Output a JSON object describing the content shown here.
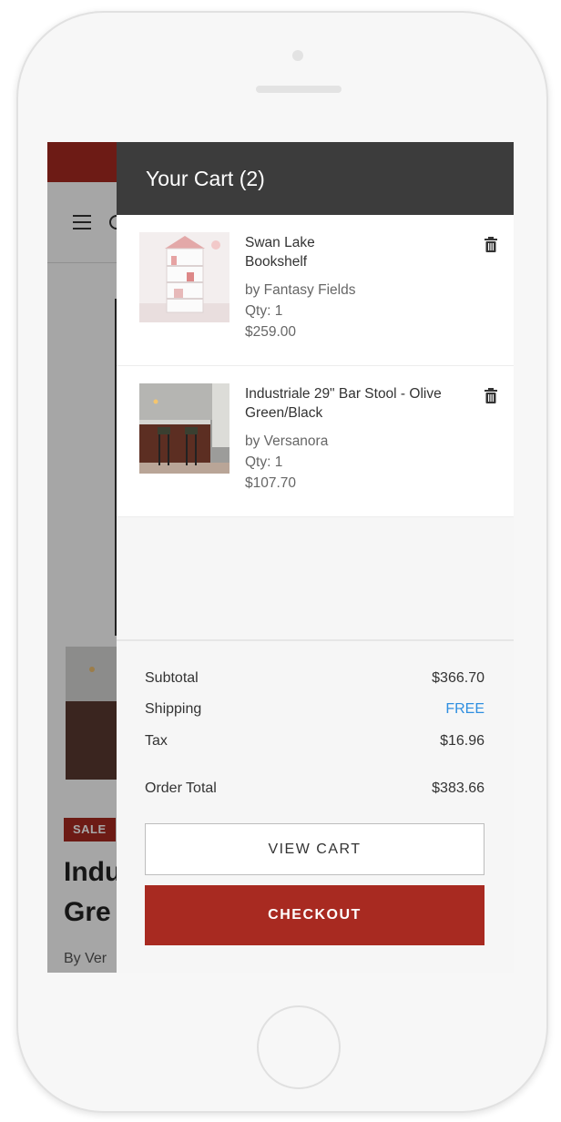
{
  "cart": {
    "title": "Your Cart (2)",
    "items": [
      {
        "name": "Swan Lake Bookshelf",
        "brand": "by Fantasy Fields",
        "qty": "Qty: 1",
        "price": "$259.00",
        "image_icon": "bookshelf-photo"
      },
      {
        "name": "Industriale 29\" Bar Stool - Olive Green/Black",
        "brand": "by Versanora",
        "qty": "Qty: 1",
        "price": "$107.70",
        "image_icon": "bar-stool-photo"
      }
    ],
    "summary": {
      "subtotal_label": "Subtotal",
      "subtotal_value": "$366.70",
      "shipping_label": "Shipping",
      "shipping_value": "FREE",
      "tax_label": "Tax",
      "tax_value": "$16.96",
      "total_label": "Order Total",
      "total_value": "$383.66"
    },
    "buttons": {
      "view_cart": "VIEW CART",
      "checkout": "CHECKOUT"
    }
  },
  "background_page": {
    "sale_badge": "SALE",
    "title_line1": "Indu",
    "title_line2": "Gre",
    "by_text": "By Ver"
  },
  "colors": {
    "brand_red": "#a82a21",
    "header_dark": "#3c3c3c",
    "free_blue": "#2f8fe0"
  }
}
